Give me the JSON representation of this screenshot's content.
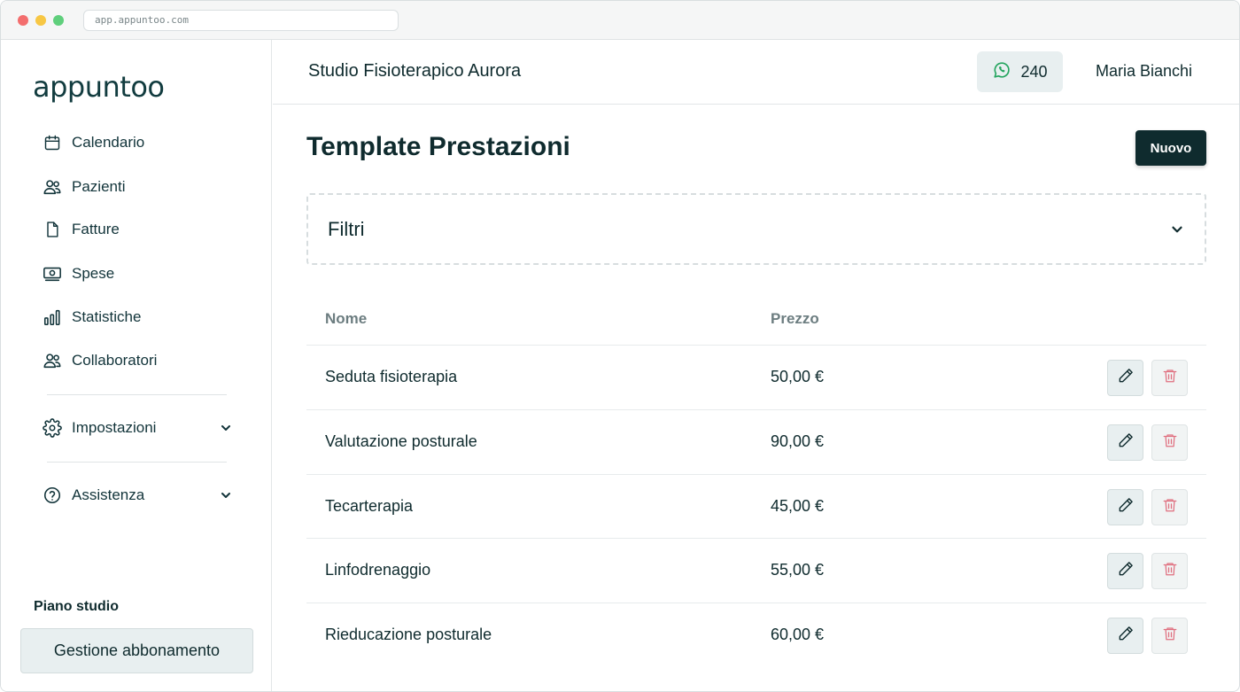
{
  "browser": {
    "url": "app.appuntoo.com"
  },
  "sidebar": {
    "logo": "appuntoo",
    "items": [
      {
        "label": "Calendario",
        "icon": "calendar-icon"
      },
      {
        "label": "Pazienti",
        "icon": "users-icon"
      },
      {
        "label": "Fatture",
        "icon": "document-icon"
      },
      {
        "label": "Spese",
        "icon": "money-icon"
      },
      {
        "label": "Statistiche",
        "icon": "bar-chart-icon"
      },
      {
        "label": "Collaboratori",
        "icon": "users-icon"
      },
      {
        "label": "Impostazioni",
        "icon": "gear-icon"
      },
      {
        "label": "Assistenza",
        "icon": "help-icon"
      }
    ],
    "plan_label": "Piano studio",
    "plan_button": "Gestione abbonamento"
  },
  "header": {
    "studio_name": "Studio Fisioterapico Aurora",
    "whatsapp_count": "240",
    "user_name": "Maria Bianchi"
  },
  "main": {
    "title": "Template Prestazioni",
    "new_button": "Nuovo",
    "filters_label": "Filtri",
    "table": {
      "columns": [
        "Nome",
        "Prezzo"
      ],
      "rows": [
        {
          "name": "Seduta fisioterapia",
          "price": "50,00 €"
        },
        {
          "name": "Valutazione posturale",
          "price": "90,00 €"
        },
        {
          "name": "Tecarterapia",
          "price": "45,00 €"
        },
        {
          "name": "Linfodrenaggio",
          "price": "55,00 €"
        },
        {
          "name": "Rieducazione posturale",
          "price": "60,00 €"
        }
      ]
    }
  },
  "colors": {
    "brand": "#0f2b2e",
    "whatsapp": "#25a55f",
    "danger": "#e07080",
    "muted": "#6c7d80"
  }
}
